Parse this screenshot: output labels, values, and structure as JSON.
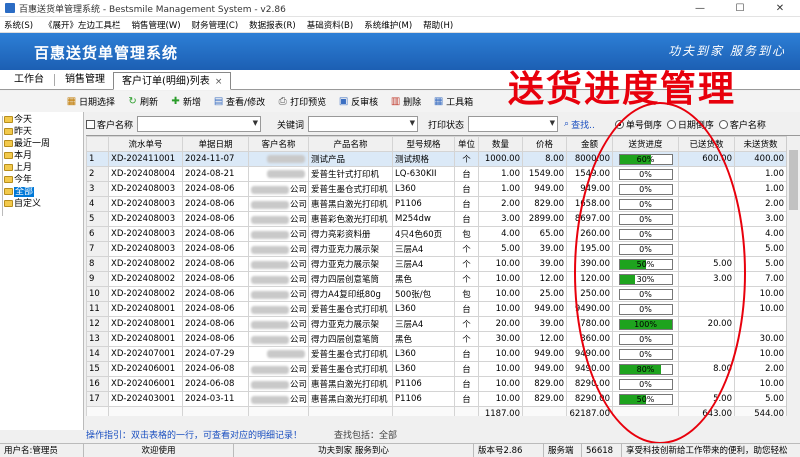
{
  "window": {
    "title": "百惠送货单管理系统 - Bestsmile Management System - v2.86"
  },
  "menu": [
    "系统(S)",
    "《展开》左边工具栏",
    "销售管理(W)",
    "财务管理(C)",
    "数据报表(R)",
    "基础资料(B)",
    "系统维护(M)",
    "帮助(H)"
  ],
  "banner": {
    "title": "百惠送货单管理系统",
    "slogan": "功夫到家 服务到心"
  },
  "tabs": [
    "工作台",
    "销售管理",
    "客户订单(明细)列表"
  ],
  "overlay_title": "送货进度管理",
  "toolbar": [
    "日期选择",
    "刷新",
    "新增",
    "查看/修改",
    "打印预览",
    "反审核",
    "删除",
    "工具箱"
  ],
  "tree": [
    "今天",
    "昨天",
    "最近一周",
    "本月",
    "上月",
    "今年",
    "全部",
    "自定义"
  ],
  "filter": {
    "customer_label": "客户名称",
    "keyword_label": "关键词",
    "print_status_label": "打印状态",
    "search": "查找..",
    "sort_options": [
      "单号倒序",
      "日期倒序",
      "客户名称"
    ]
  },
  "columns": [
    "",
    "流水单号",
    "单据日期",
    "客户名称",
    "产品名称",
    "型号规格",
    "单位",
    "数量",
    "价格",
    "金额",
    "送货进度",
    "已送货数",
    "未送货数"
  ],
  "rows": [
    {
      "n": "1",
      "no": "XD-202411001",
      "date": "2024-11-07",
      "cust": "",
      "prod": "测试产品",
      "spec": "测试规格",
      "unit": "个",
      "qty": "1000.00",
      "price": "8.00",
      "amt": "8000.00",
      "prog": "60%",
      "pv": 60,
      "sent": "600.00",
      "unsent": "400.00"
    },
    {
      "n": "2",
      "no": "XD-202408004",
      "date": "2024-08-21",
      "cust": "",
      "prod": "爱普生针式打印机",
      "spec": "LQ-630KII",
      "unit": "台",
      "qty": "1.00",
      "price": "1549.00",
      "amt": "1549.00",
      "prog": "0%",
      "pv": 0,
      "sent": "",
      "unsent": "1.00"
    },
    {
      "n": "3",
      "no": "XD-202408003",
      "date": "2024-08-06",
      "cust": "公司",
      "prod": "爱普生墨仓式打印机",
      "spec": "L360",
      "unit": "台",
      "qty": "1.00",
      "price": "949.00",
      "amt": "949.00",
      "prog": "0%",
      "pv": 0,
      "sent": "",
      "unsent": "1.00"
    },
    {
      "n": "4",
      "no": "XD-202408003",
      "date": "2024-08-06",
      "cust": "公司",
      "prod": "惠普黑白激光打印机",
      "spec": "P1106",
      "unit": "台",
      "qty": "2.00",
      "price": "829.00",
      "amt": "1658.00",
      "prog": "0%",
      "pv": 0,
      "sent": "",
      "unsent": "2.00"
    },
    {
      "n": "5",
      "no": "XD-202408003",
      "date": "2024-08-06",
      "cust": "公司",
      "prod": "惠普彩色激光打印机",
      "spec": "M254dw",
      "unit": "台",
      "qty": "3.00",
      "price": "2899.00",
      "amt": "8697.00",
      "prog": "0%",
      "pv": 0,
      "sent": "",
      "unsent": "3.00"
    },
    {
      "n": "6",
      "no": "XD-202408003",
      "date": "2024-08-06",
      "cust": "公司",
      "prod": "得力亮彩资料册",
      "spec": "4只4色60页",
      "unit": "包",
      "qty": "4.00",
      "price": "65.00",
      "amt": "260.00",
      "prog": "0%",
      "pv": 0,
      "sent": "",
      "unsent": "4.00"
    },
    {
      "n": "7",
      "no": "XD-202408003",
      "date": "2024-08-06",
      "cust": "公司",
      "prod": "得力亚克力展示架",
      "spec": "三层A4",
      "unit": "个",
      "qty": "5.00",
      "price": "39.00",
      "amt": "195.00",
      "prog": "0%",
      "pv": 0,
      "sent": "",
      "unsent": "5.00"
    },
    {
      "n": "8",
      "no": "XD-202408002",
      "date": "2024-08-06",
      "cust": "公司",
      "prod": "得力亚克力展示架",
      "spec": "三层A4",
      "unit": "个",
      "qty": "10.00",
      "price": "39.00",
      "amt": "390.00",
      "prog": "50%",
      "pv": 50,
      "sent": "5.00",
      "unsent": "5.00"
    },
    {
      "n": "9",
      "no": "XD-202408002",
      "date": "2024-08-06",
      "cust": "公司",
      "prod": "得力四层创意笔筒",
      "spec": "黑色",
      "unit": "个",
      "qty": "10.00",
      "price": "12.00",
      "amt": "120.00",
      "prog": "30%",
      "pv": 30,
      "sent": "3.00",
      "unsent": "7.00"
    },
    {
      "n": "10",
      "no": "XD-202408002",
      "date": "2024-08-06",
      "cust": "公司",
      "prod": "得力A4复印纸80g",
      "spec": "500张/包",
      "unit": "包",
      "qty": "10.00",
      "price": "25.00",
      "amt": "250.00",
      "prog": "0%",
      "pv": 0,
      "sent": "",
      "unsent": "10.00"
    },
    {
      "n": "11",
      "no": "XD-202408001",
      "date": "2024-08-06",
      "cust": "公司",
      "prod": "爱普生墨仓式打印机",
      "spec": "L360",
      "unit": "台",
      "qty": "10.00",
      "price": "949.00",
      "amt": "9490.00",
      "prog": "0%",
      "pv": 0,
      "sent": "",
      "unsent": "10.00"
    },
    {
      "n": "12",
      "no": "XD-202408001",
      "date": "2024-08-06",
      "cust": "公司",
      "prod": "得力亚克力展示架",
      "spec": "三层A4",
      "unit": "个",
      "qty": "20.00",
      "price": "39.00",
      "amt": "780.00",
      "prog": "100%",
      "pv": 100,
      "sent": "20.00",
      "unsent": ""
    },
    {
      "n": "13",
      "no": "XD-202408001",
      "date": "2024-08-06",
      "cust": "公司",
      "prod": "得力四层创意笔筒",
      "spec": "黑色",
      "unit": "个",
      "qty": "30.00",
      "price": "12.00",
      "amt": "360.00",
      "prog": "0%",
      "pv": 0,
      "sent": "",
      "unsent": "30.00"
    },
    {
      "n": "14",
      "no": "XD-202407001",
      "date": "2024-07-29",
      "cust": "",
      "prod": "爱普生墨仓式打印机",
      "spec": "L360",
      "unit": "台",
      "qty": "10.00",
      "price": "949.00",
      "amt": "9490.00",
      "prog": "0%",
      "pv": 0,
      "sent": "",
      "unsent": "10.00"
    },
    {
      "n": "15",
      "no": "XD-202406001",
      "date": "2024-06-08",
      "cust": "公司",
      "prod": "爱普生墨仓式打印机",
      "spec": "L360",
      "unit": "台",
      "qty": "10.00",
      "price": "949.00",
      "amt": "9490.00",
      "prog": "80%",
      "pv": 80,
      "sent": "8.00",
      "unsent": "2.00"
    },
    {
      "n": "16",
      "no": "XD-202406001",
      "date": "2024-06-08",
      "cust": "公司",
      "prod": "惠普黑白激光打印机",
      "spec": "P1106",
      "unit": "台",
      "qty": "10.00",
      "price": "829.00",
      "amt": "8290.00",
      "prog": "0%",
      "pv": 0,
      "sent": "",
      "unsent": "10.00"
    },
    {
      "n": "17",
      "no": "XD-202403001",
      "date": "2024-03-11",
      "cust": "公司",
      "prod": "惠普黑白激光打印机",
      "spec": "P1106",
      "unit": "台",
      "qty": "10.00",
      "price": "829.00",
      "amt": "8290.00",
      "prog": "50%",
      "pv": 50,
      "sent": "5.00",
      "unsent": "5.00"
    }
  ],
  "totals": {
    "qty": "1187.00",
    "amt": "62187.00",
    "sent": "643.00",
    "unsent": "544.00"
  },
  "hint": {
    "tip": "操作指引：双击表格的一行，可查看对应的明细记录！",
    "search_status": "查找包括：全部"
  },
  "status": [
    "用户名:管理员",
    "欢迎使用",
    "功夫到家 服务到心",
    "版本号2.86",
    "服务端",
    "56618",
    "享受科技创新给工作带来的便利，助您轻松"
  ]
}
